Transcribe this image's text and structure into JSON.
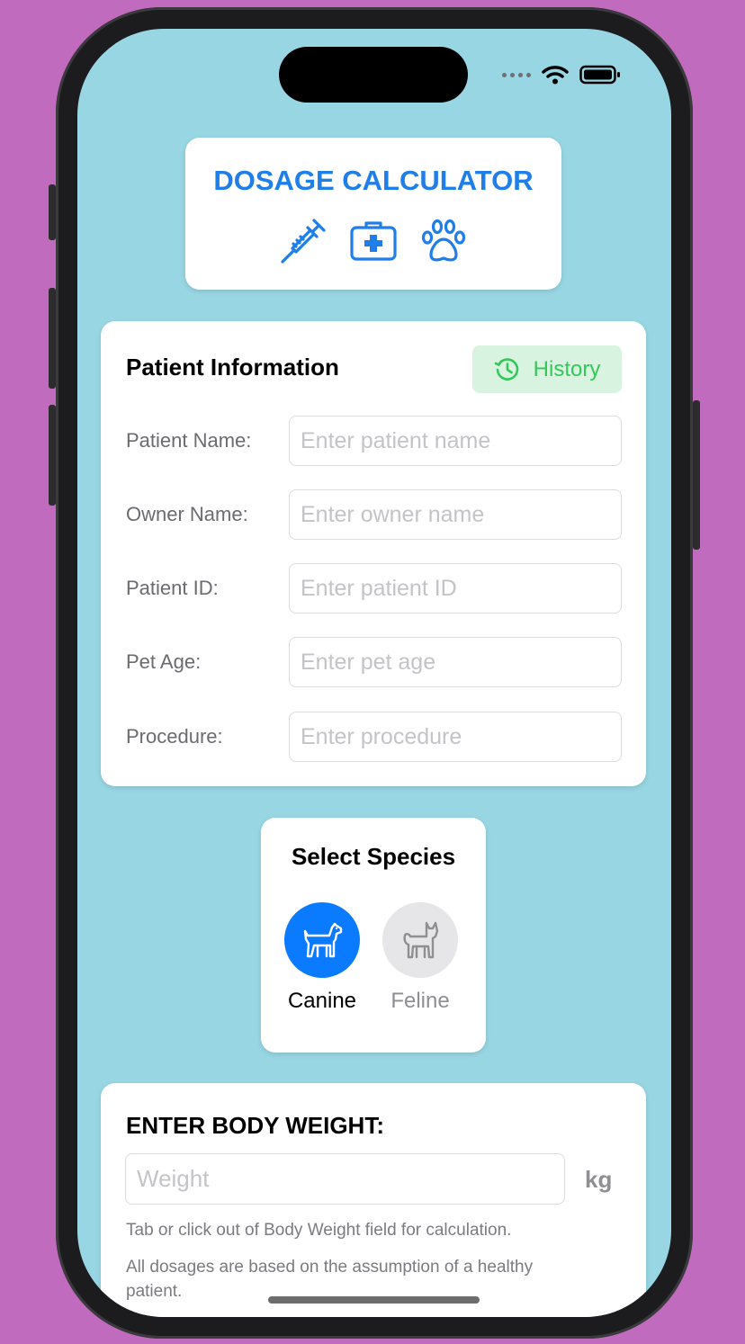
{
  "app": {
    "title": "DOSAGE CALCULATOR",
    "accent_color": "#1f7ee8",
    "background_color": "#98d6e3",
    "header_icons": [
      "syringe-icon",
      "medical-kit-icon",
      "paw-icon"
    ]
  },
  "patient_info": {
    "title": "Patient Information",
    "history_button": {
      "label": "History",
      "icon": "clock-history-icon",
      "color": "#34c759"
    },
    "fields": [
      {
        "label": "Patient Name:",
        "placeholder": "Enter patient name",
        "value": ""
      },
      {
        "label": "Owner Name:",
        "placeholder": "Enter owner name",
        "value": ""
      },
      {
        "label": "Patient ID:",
        "placeholder": "Enter patient ID",
        "value": ""
      },
      {
        "label": "Pet Age:",
        "placeholder": "Enter pet age",
        "value": ""
      },
      {
        "label": "Procedure:",
        "placeholder": "Enter procedure",
        "value": ""
      }
    ]
  },
  "species": {
    "title": "Select Species",
    "selected": "Canine",
    "options": [
      {
        "label": "Canine",
        "icon": "dog-icon"
      },
      {
        "label": "Feline",
        "icon": "cat-icon"
      }
    ]
  },
  "body_weight": {
    "title": "ENTER BODY WEIGHT:",
    "placeholder": "Weight",
    "value": "",
    "unit": "kg",
    "hint": "Tab or click out of Body Weight field for calculation.",
    "disclaimer": "All dosages are based on the assumption of a healthy patient."
  }
}
